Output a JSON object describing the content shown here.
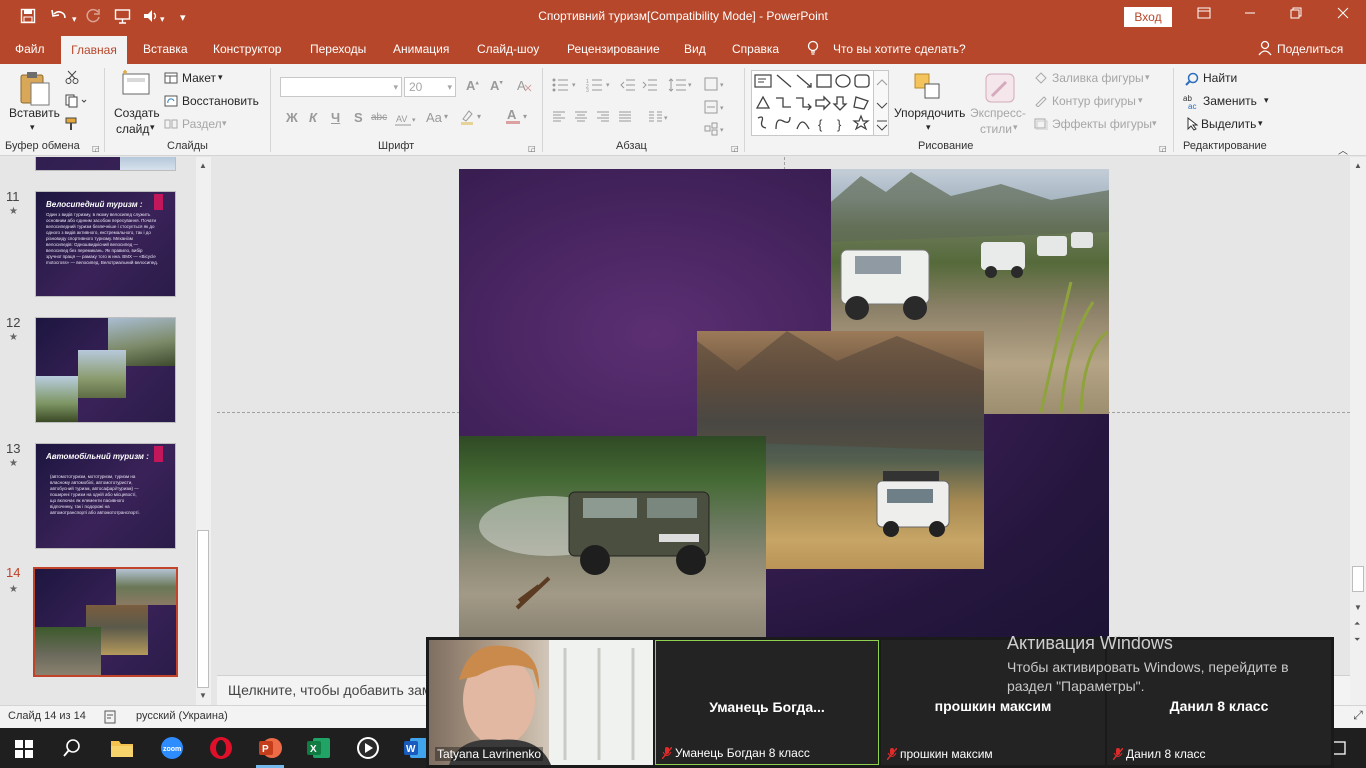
{
  "title_bar": {
    "document_title": "Спортивний туризм[Compatibility Mode]  -  PowerPoint",
    "sign_in": "Вход"
  },
  "tabs": [
    "Файл",
    "Главная",
    "Вставка",
    "Конструктор",
    "Переходы",
    "Анимация",
    "Слайд-шоу",
    "Рецензирование",
    "Вид",
    "Справка"
  ],
  "tell_me": "Что вы хотите сделать?",
  "share": "Поделиться",
  "ribbon": {
    "clipboard": {
      "paste": "Вставить",
      "label": "Буфер обмена"
    },
    "slides": {
      "new_slide_line1": "Создать",
      "new_slide_line2": "слайд",
      "layout": "Макет",
      "reset": "Восстановить",
      "section": "Раздел",
      "label": "Слайды"
    },
    "font": {
      "size": "20",
      "label": "Шрифт",
      "bold": "Ж",
      "italic": "К",
      "underline": "Ч",
      "shadow": "S",
      "strike": "abc",
      "case": "Aa"
    },
    "paragraph": {
      "label": "Абзац"
    },
    "drawing": {
      "arrange": "Упорядочить",
      "quick_styles_line1": "Экспресс-",
      "quick_styles_line2": "стили",
      "fill": "Заливка фигуры",
      "outline": "Контур фигуры",
      "effects": "Эффекты фигуры",
      "label": "Рисование"
    },
    "editing": {
      "find": "Найти",
      "replace": "Заменить",
      "select": "Выделить",
      "label": "Редактирование"
    }
  },
  "thumbnails": [
    {
      "num": "11",
      "title": "Велосипедний туризм :",
      "text": "Один з видів туризму, в якому велосипед служить основним або єдиним засобом пересування. Почати велосипедний туризм безпечніше і стосується як до одного з видів активного, екстремального, так і до різновиду спортивного туризму. Механізм велосипедів: Одношвидкісний велосипед — велосипед без перемикань. Як правило, вибір зручної праця — рамаку того ж ина. ВМХ — «Bicycle motocross» — велосипед. Велотриальний велосипед."
    },
    {
      "num": "12"
    },
    {
      "num": "13",
      "title": "Автомобільний туризм :",
      "text": "(автомототуризм, мототуризм, туризм на власному автомобілі, автомототуристи, автобусний туризм, автосафарі/туризм) — поширені туризм на одній або місцевості, що включає як елементи пасивного відпочинку, так і подорожі на автомотранспорті або автомототранспорті."
    },
    {
      "num": "14"
    }
  ],
  "notes_placeholder": "Щелкните, чтобы добавить заметки",
  "status": {
    "slide": "Слайд 14 из 14",
    "language": "русский (Украина)"
  },
  "activation": {
    "title": "Активация Windows",
    "line1": "Чтобы активировать Windows, перейдите в",
    "line2": "раздел \"Параметры\"."
  },
  "zoom": {
    "participants": [
      {
        "label": "Tatyana Lavrinenko"
      },
      {
        "name": "Уманець  Богда...",
        "label": "Уманець Богдан 8 класс"
      },
      {
        "name": "прошкин максим",
        "label": "прошкин максим"
      },
      {
        "name": "Данил 8 класс",
        "label": "Данил 8 класс"
      }
    ]
  },
  "colors": {
    "accent": "#b7472a",
    "ribbon_bg": "#f3f3f3",
    "slide_purple": "#3e2057"
  }
}
